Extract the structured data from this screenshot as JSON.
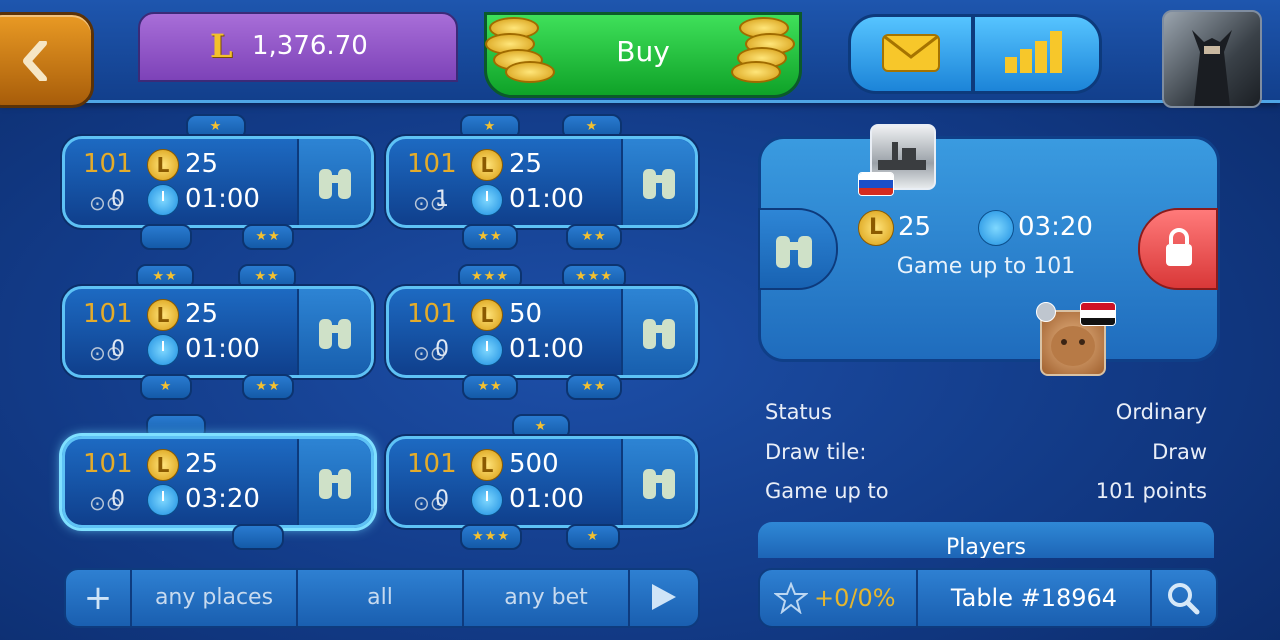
{
  "top": {
    "balance": "1,376.70",
    "currency_icon": "L",
    "buy_label": "Buy"
  },
  "colors": {
    "gold": "#e4ac2a",
    "green": "#1fbf3a",
    "purple": "#8d52c8",
    "red": "#e84a4a"
  },
  "tables": [
    {
      "game": "101",
      "coin": "L",
      "bet": "25",
      "watchers": "0",
      "time": "01:00",
      "top": [
        "★"
      ],
      "bottom": [
        "",
        "★★"
      ]
    },
    {
      "game": "101",
      "coin": "L",
      "bet": "25",
      "watchers": "1",
      "time": "01:00",
      "top": [
        "★",
        "★"
      ],
      "bottom": [
        "★★",
        "★★"
      ]
    },
    {
      "game": "101",
      "coin": "L",
      "bet": "25",
      "watchers": "0",
      "time": "01:00",
      "top": [
        "★★",
        "★★"
      ],
      "bottom": [
        "★",
        "★★"
      ]
    },
    {
      "game": "101",
      "coin": "L",
      "bet": "50",
      "watchers": "0",
      "time": "01:00",
      "top": [
        "★★★",
        "★★★"
      ],
      "bottom": [
        "★★",
        "★★"
      ]
    },
    {
      "game": "101",
      "coin": "L",
      "bet": "25",
      "watchers": "0",
      "time": "03:20",
      "top": [
        ""
      ],
      "bottom": [
        ""
      ]
    },
    {
      "game": "101",
      "coin": "L",
      "bet": "500",
      "watchers": "0",
      "time": "01:00",
      "top": [
        "★"
      ],
      "bottom": [
        "★★★",
        "★"
      ]
    }
  ],
  "detail": {
    "coin": "L",
    "bet": "25",
    "time": "03:20",
    "subtitle": "Game up to 101"
  },
  "info": [
    {
      "label": "Status",
      "value": "Ordinary"
    },
    {
      "label": "Draw tile:",
      "value": "Draw"
    },
    {
      "label": "Game up to",
      "value": "101 points"
    }
  ],
  "players_label": "Players",
  "filters": {
    "places": "any places",
    "all": "all",
    "bet": "any bet"
  },
  "bottom": {
    "rating": "+0/0%",
    "table": "Table #18964"
  }
}
